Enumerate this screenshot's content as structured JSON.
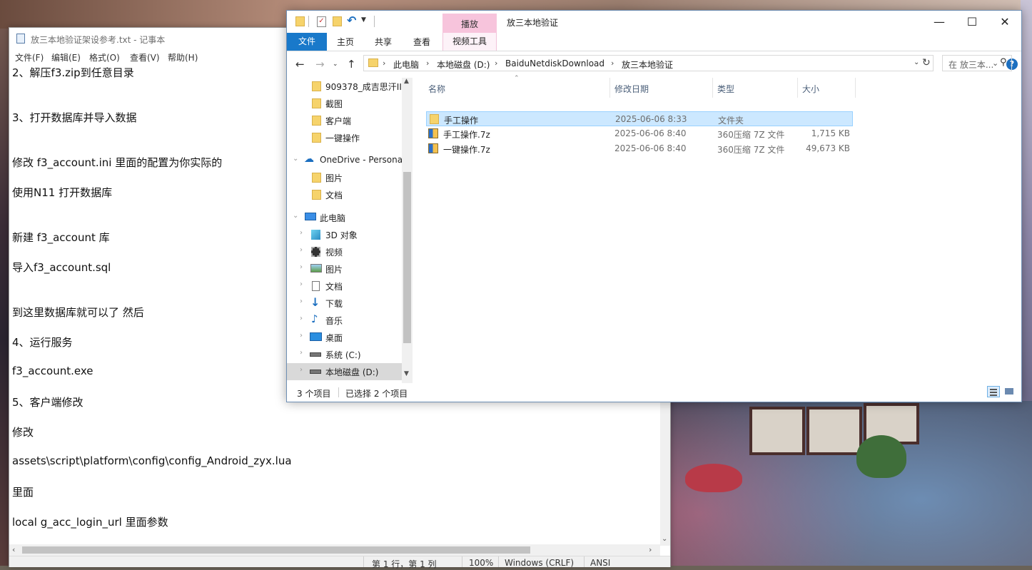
{
  "notepad": {
    "title": "放三本地验证架设参考.txt - 记事本",
    "menu": [
      "文件(F)",
      "编辑(E)",
      "格式(O)",
      "查看(V)",
      "帮助(H)"
    ],
    "lines": [
      "2、解压f3.zip到任意目录",
      "3、打开数据库并导入数据",
      "修改 f3_account.ini 里面的配置为你实际的",
      "使用N11 打开数据库",
      "新建 f3_account 库",
      "导入f3_account.sql",
      "到这里数据库就可以了 然后",
      "4、运行服务",
      "f3_account.exe",
      "5、客户端修改",
      "修改",
      "assets\\script\\platform\\config\\config_Android_zyx.lua",
      "里面",
      "local g_acc_login_url 里面参数"
    ],
    "status": {
      "position": "第 1 行，第 1 列",
      "zoom": "100%",
      "line_ending": "Windows (CRLF)",
      "encoding": "ANSI"
    }
  },
  "explorer": {
    "title": "放三本地验证",
    "context_tab_group": "播放",
    "tabs": {
      "file": "文件",
      "home": "主页",
      "share": "共享",
      "view": "查看",
      "video_tools": "视频工具"
    },
    "help": "?",
    "address": [
      "此电脑",
      "本地磁盘 (D:)",
      "BaiduNetdiskDownload",
      "放三本地验证"
    ],
    "search_placeholder": "在 放三本...",
    "nav": [
      {
        "label": "909378_成吉思汗III",
        "icon": "folder-icon"
      },
      {
        "label": "截图",
        "icon": "folder-icon"
      },
      {
        "label": "客户端",
        "icon": "folder-icon"
      },
      {
        "label": "一键操作",
        "icon": "folder-icon"
      },
      {
        "label": "OneDrive - Persona",
        "icon": "onedrive-icon"
      },
      {
        "label": "图片",
        "icon": "folder-icon"
      },
      {
        "label": "文档",
        "icon": "folder-icon"
      },
      {
        "label": "此电脑",
        "icon": "computer-icon"
      },
      {
        "label": "3D 对象",
        "icon": "cube-icon"
      },
      {
        "label": "视频",
        "icon": "video-icon"
      },
      {
        "label": "图片",
        "icon": "pictures-icon"
      },
      {
        "label": "文档",
        "icon": "document-icon"
      },
      {
        "label": "下载",
        "icon": "download-icon"
      },
      {
        "label": "音乐",
        "icon": "music-icon"
      },
      {
        "label": "桌面",
        "icon": "desktop-icon"
      },
      {
        "label": "系统 (C:)",
        "icon": "drive-icon"
      },
      {
        "label": "本地磁盘 (D:)",
        "icon": "drive-icon"
      }
    ],
    "columns": [
      "名称",
      "修改日期",
      "类型",
      "大小"
    ],
    "files": [
      {
        "name": "手工操作",
        "date": "2025-06-06 8:33",
        "type": "文件夹",
        "size": "",
        "icon": "folder-icon",
        "selected": true
      },
      {
        "name": "手工操作.7z",
        "date": "2025-06-06 8:40",
        "type": "360压缩 7Z 文件",
        "size": "1,715 KB",
        "icon": "archive-icon",
        "selected": false
      },
      {
        "name": "一键操作.7z",
        "date": "2025-06-06 8:40",
        "type": "360压缩 7Z 文件",
        "size": "49,673 KB",
        "icon": "archive-icon",
        "selected": false
      }
    ],
    "status": {
      "count": "3 个项目",
      "selected": "已选择 2 个项目"
    }
  }
}
